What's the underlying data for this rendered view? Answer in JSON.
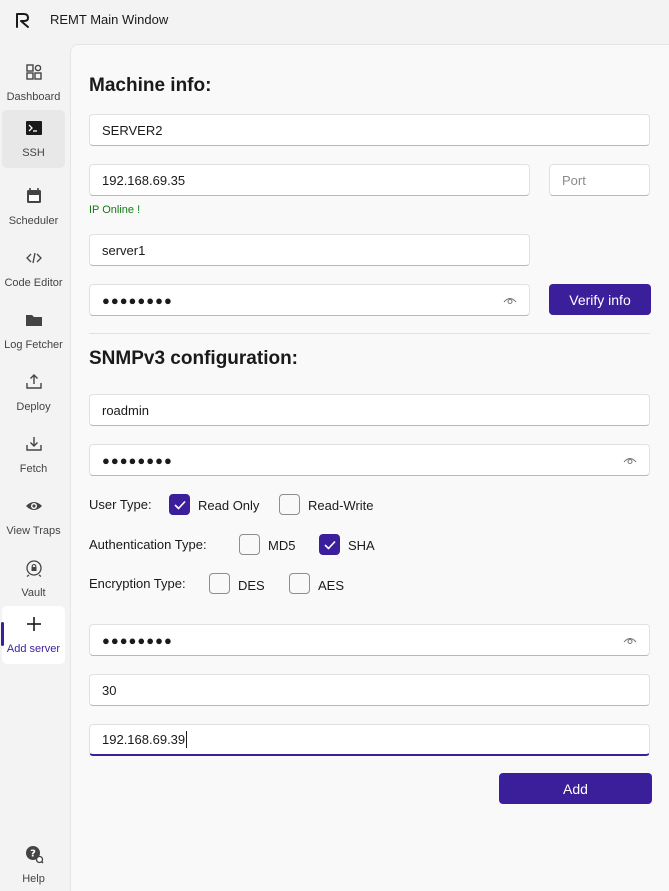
{
  "window": {
    "title": "REMT Main Window"
  },
  "sidebar": {
    "items": [
      {
        "label": "Dashboard"
      },
      {
        "label": "SSH"
      },
      {
        "label": "Scheduler"
      },
      {
        "label": "Code Editor"
      },
      {
        "label": "Log Fetcher"
      },
      {
        "label": "Deploy"
      },
      {
        "label": "Fetch"
      },
      {
        "label": "View Traps"
      },
      {
        "label": "Vault"
      },
      {
        "label": "Add server"
      }
    ],
    "help_label": "Help",
    "active_item": "Add server"
  },
  "machine": {
    "heading": "Machine info:",
    "name_value": "SERVER2",
    "ip_value": "192.168.69.35",
    "port_placeholder": "Port",
    "ip_status": "IP Online !",
    "username_value": "server1",
    "password_dots": "●●●●●●●●",
    "verify_label": "Verify info"
  },
  "snmp": {
    "heading": "SNMPv3 configuration:",
    "username_value": "roadmin",
    "auth_password_dots": "●●●●●●●●",
    "user_type": {
      "label": "User Type:",
      "options": [
        {
          "label": "Read Only",
          "checked": true
        },
        {
          "label": "Read-Write",
          "checked": false
        }
      ]
    },
    "auth_type": {
      "label": "Authentication Type:",
      "options": [
        {
          "label": "MD5",
          "checked": false
        },
        {
          "label": "SHA",
          "checked": true
        }
      ]
    },
    "enc_type": {
      "label": "Encryption Type:",
      "options": [
        {
          "label": "DES",
          "checked": false
        },
        {
          "label": "AES",
          "checked": false
        }
      ]
    },
    "priv_password_dots": "●●●●●●●●",
    "interval_value": "30",
    "trap_ip_value": "192.168.69.39",
    "add_label": "Add"
  },
  "colors": {
    "accent": "#3b1f9a",
    "status_ok": "#137a13"
  }
}
